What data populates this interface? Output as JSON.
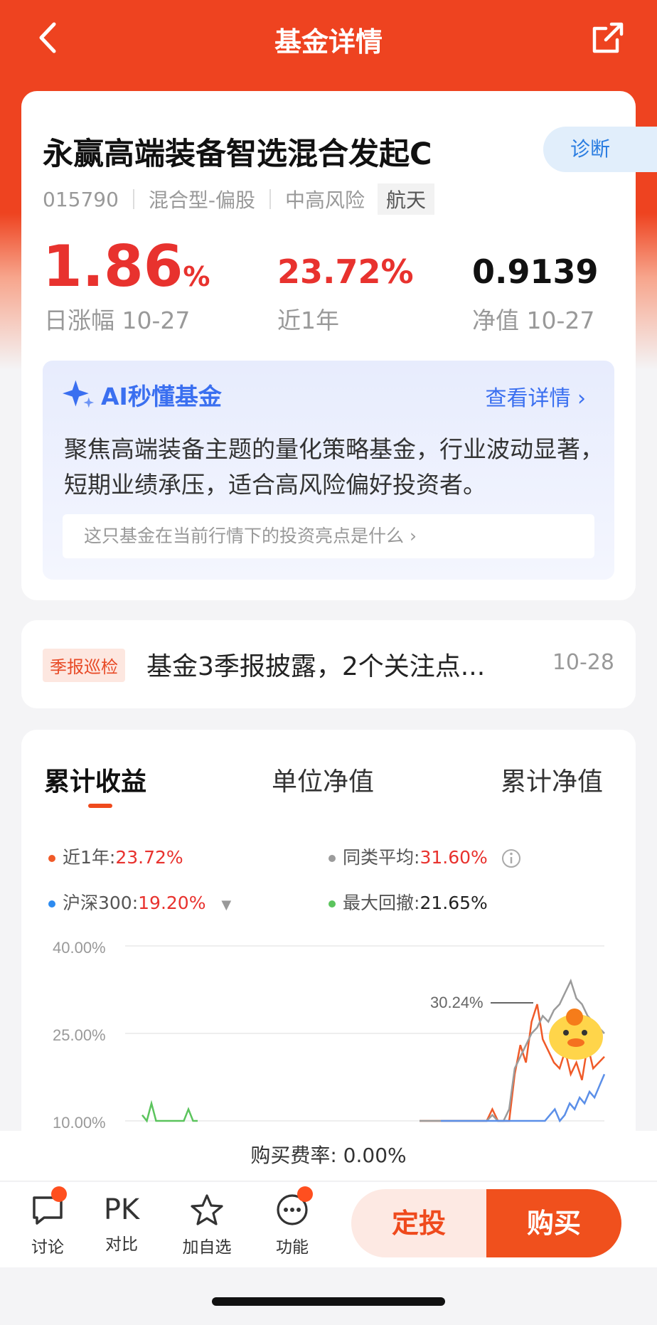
{
  "nav": {
    "title": "基金详情"
  },
  "fund": {
    "name": "永赢高端装备智选混合发起C",
    "diagnose": "诊断",
    "code": "015790",
    "type": "混合型-偏股",
    "risk": "中高风险",
    "tag": "航天",
    "daily_change": "1.86",
    "daily_change_unit": "%",
    "daily_change_label": "日涨幅 10-27",
    "year_return": "23.72%",
    "year_return_label": "近1年",
    "nav_value": "0.9139",
    "nav_label": "净值 10-27"
  },
  "ai": {
    "title": "AI秒懂基金",
    "link": "查看详情",
    "text": "聚焦高端装备主题的量化策略基金，行业波动显著，短期业绩承压，适合高风险偏好投资者。",
    "question": "这只基金在当前行情下的投资亮点是什么"
  },
  "report": {
    "tag": "季报巡检",
    "text": "基金3季报披露，2个关注点...",
    "date": "10-28"
  },
  "chart_tabs": [
    "累计收益",
    "单位净值",
    "累计净值"
  ],
  "legend": {
    "fund_label": "近1年:",
    "fund_value": "23.72%",
    "peer_label": "同类平均:",
    "peer_value": "31.60%",
    "index_label": "沪深300:",
    "index_value": "19.20%",
    "drawdown_label": "最大回撤:",
    "drawdown_value": "21.65%"
  },
  "chart_data": {
    "type": "line",
    "yticks": [
      "40.00%",
      "25.00%",
      "10.00%"
    ],
    "annotation": "30.24%",
    "series": [
      {
        "color": "#f05a28",
        "values": [
          -2,
          2,
          8,
          4,
          7,
          5,
          4,
          9,
          10,
          8,
          6,
          4,
          9,
          12,
          8,
          6,
          9,
          18,
          23,
          20,
          27,
          30,
          24,
          22,
          20,
          19,
          22,
          18,
          20,
          17,
          23,
          19,
          20,
          21
        ]
      },
      {
        "color": "#9b9b9b",
        "values": [
          -3,
          1,
          5,
          3,
          6,
          4,
          3,
          7,
          8,
          7,
          5,
          4,
          8,
          11,
          10,
          9,
          12,
          19,
          21,
          23,
          25,
          26,
          28,
          27,
          29,
          30,
          32,
          34,
          31,
          30,
          28,
          27,
          26,
          25
        ]
      },
      {
        "color": "#5b8fe8",
        "values": [
          -6,
          -5,
          -4,
          -6,
          -5,
          -4,
          -6,
          -5,
          -3,
          -4,
          -6,
          -5,
          -4,
          -2,
          0,
          2,
          3,
          5,
          6,
          8,
          10,
          9,
          11,
          12,
          10,
          11,
          13,
          12,
          14,
          13,
          15,
          14,
          16,
          18
        ]
      }
    ],
    "green_values": [
      11,
      4,
      13,
      8,
      6,
      9,
      5,
      7,
      6,
      8,
      12,
      9,
      10
    ]
  },
  "bottom": {
    "fee": "购买费率: 0.00%",
    "discuss": "讨论",
    "pk": "PK",
    "compare": "对比",
    "watch": "加自选",
    "func": "功能",
    "sip": "定投",
    "buy": "购买"
  }
}
